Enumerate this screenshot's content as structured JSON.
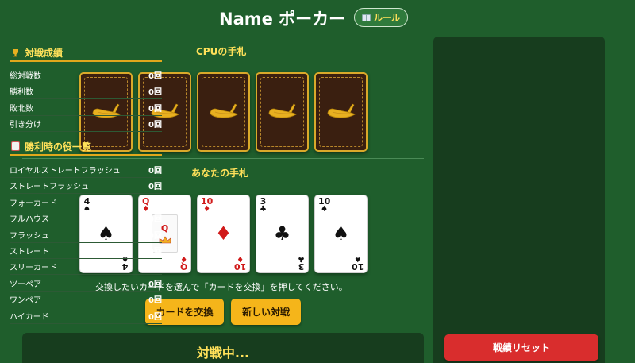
{
  "header": {
    "title": "Name ポーカー",
    "rules_label": "ルール"
  },
  "cpu_hand": {
    "label": "CPUの手札",
    "card_count": 5
  },
  "player_hand": {
    "label": "あなたの手札",
    "cards": [
      {
        "rank": "4",
        "suit": "♠",
        "color": "black"
      },
      {
        "rank": "Q",
        "suit": "♦",
        "color": "red"
      },
      {
        "rank": "10",
        "suit": "♦",
        "color": "red"
      },
      {
        "rank": "3",
        "suit": "♣",
        "color": "black"
      },
      {
        "rank": "10",
        "suit": "♠",
        "color": "black"
      }
    ],
    "hint": "交換したいカードを選んで「カードを交換」を押してください。",
    "exchange_label": "カードを交換",
    "new_game_label": "新しい対戦"
  },
  "status": {
    "text": "対戦中..."
  },
  "sidebar": {
    "record_title": "対戦成績",
    "record_icon": "trophy-icon",
    "record_rows": [
      {
        "label": "総対戦数",
        "value": "0回"
      },
      {
        "label": "勝利数",
        "value": "0回"
      },
      {
        "label": "敗北数",
        "value": "0回"
      },
      {
        "label": "引き分け",
        "value": "0回"
      }
    ],
    "hands_title": "勝利時の役一覧",
    "hands_icon": "cards-icon",
    "hand_rows": [
      {
        "label": "ロイヤルストレートフラッシュ",
        "value": "0回"
      },
      {
        "label": "ストレートフラッシュ",
        "value": "0回"
      },
      {
        "label": "フォーカード",
        "value": "0回"
      },
      {
        "label": "フルハウス",
        "value": "0回"
      },
      {
        "label": "フラッシュ",
        "value": "0回"
      },
      {
        "label": "ストレート",
        "value": "0回"
      },
      {
        "label": "スリーカード",
        "value": "0回"
      },
      {
        "label": "ツーペア",
        "value": "0回"
      },
      {
        "label": "ワンペア",
        "value": "0回"
      },
      {
        "label": "ハイカード",
        "value": "0回"
      }
    ],
    "reset_label": "戦績リセット"
  },
  "colors": {
    "background": "#1f5e2c",
    "accent_yellow": "#ffe15a",
    "button_gold": "#f5b51a",
    "reset_red": "#d92d2d",
    "card_back": "#3a1f10",
    "suit_red": "#d11a1a"
  }
}
